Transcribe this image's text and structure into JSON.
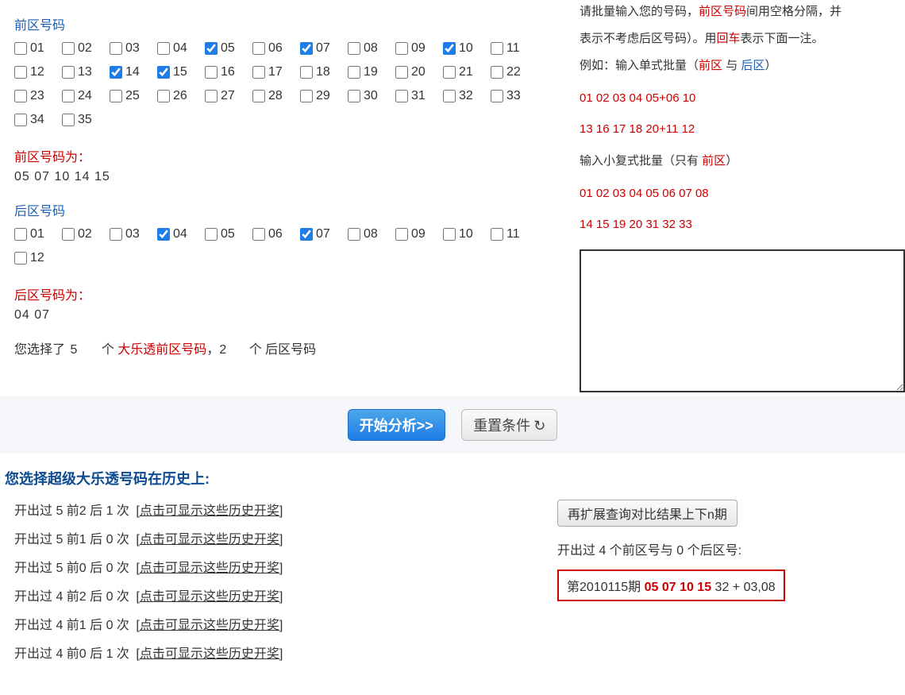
{
  "front": {
    "title": "前区号码",
    "count": 35,
    "checked": [
      5,
      7,
      10,
      14,
      15
    ],
    "result_label": "前区号码为：",
    "result_values": "05  07  10  14  15"
  },
  "back": {
    "title": "后区号码",
    "count": 12,
    "checked": [
      4,
      7
    ],
    "result_label": "后区号码为：",
    "result_values": "04  07"
  },
  "summary": {
    "prefix": "您选择了",
    "front_count": "5",
    "unit1": "个",
    "lottery_name": "大乐透前区号码",
    "comma": "，",
    "back_count": "2",
    "unit2": "个 后区号码"
  },
  "instructions": {
    "line1_a": "请批量输入您的号码，",
    "line1_b": "前区号码",
    "line1_c": "间用空格分隔，并",
    "line2_a": "表示不考虑后区号码）。用",
    "line2_b": "回车",
    "line2_c": "表示下面一注。",
    "line3_a": "例如：输入单式批量（",
    "line3_b": "前区",
    "line3_c": " 与 ",
    "line3_d": "后区",
    "line3_e": "）",
    "ex1": "01 02 03 04 05+06 10",
    "ex2": "13 16 17 18 20+11 12",
    "line4_a": "输入小复式批量（只有 ",
    "line4_b": "前区",
    "line4_c": "）",
    "ex3": "01 02 03 04 05 06 07 08",
    "ex4": "14 15 19 20 31 32 33"
  },
  "actions": {
    "analyze": "开始分析>>",
    "reset": "重置条件",
    "reset_icon": "↻"
  },
  "history": {
    "title": "您选择超级大乐透号码在历史上:",
    "link_text": "[点击可显示这些历史开奖]",
    "rows": [
      "开出过 5 前2 后 1 次",
      "开出过 5 前1 后 0 次",
      "开出过 5 前0 后 0 次",
      "开出过 4 前2 后 0 次",
      "开出过 4 前1 后 0 次",
      "开出过 4 前0 后 1 次"
    ],
    "extend_btn": "再扩展查询对比结果上下n期",
    "match_line": "开出过 4 个前区号与 0 个后区号:",
    "draw_prefix": "第",
    "draw_issue": "2010115",
    "draw_mid": "期 ",
    "draw_highlight": "05 07 10 15",
    "draw_rest": " 32 + 03,08"
  }
}
